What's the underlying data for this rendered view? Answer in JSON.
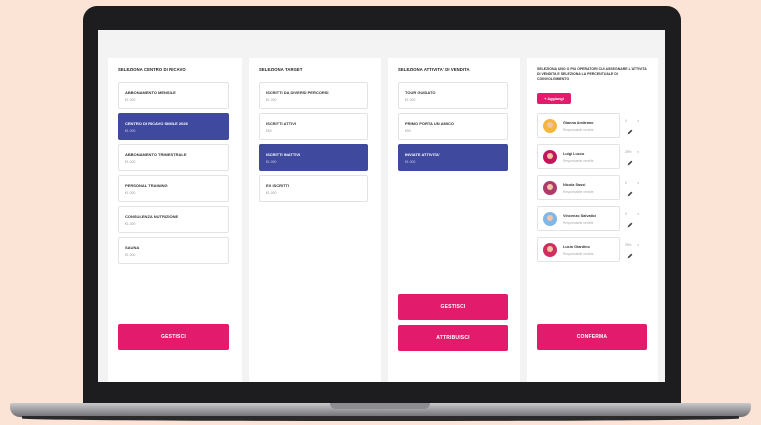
{
  "columns": {
    "centri": {
      "title": "SELEZIONA CENTRO DI RICAVO",
      "items": [
        {
          "title": "ABBONAMENTO MENSILE",
          "sub": "€1.000"
        },
        {
          "title": "CENTRO DI RICAVO SIMILE 2026",
          "sub": "€1.000"
        },
        {
          "title": "ABBONAMENTO TRIMESTRALE",
          "sub": "€1.000"
        },
        {
          "title": "PERSONAL TRAINING",
          "sub": "€1.000"
        },
        {
          "title": "CONSULENZA NUTRIZIONE",
          "sub": "€1.000"
        },
        {
          "title": "SAUNA",
          "sub": "€1.000"
        }
      ],
      "button": "GESTISCI"
    },
    "target": {
      "title": "SELEZIONA TARGET",
      "items": [
        {
          "title": "ISCRITTI DA DIVERSI PERCORSI",
          "sub": "€1.000"
        },
        {
          "title": "ISCRITTI ATTIVI",
          "sub": "€50"
        },
        {
          "title": "ISCRITTI INATTIVI",
          "sub": "€1.000"
        },
        {
          "title": "EX ISCRITTI",
          "sub": "€1.000"
        }
      ]
    },
    "attivita": {
      "title": "SELEZIONA ATTIVITA' DI VENDITA",
      "items": [
        {
          "title": "TOUR GUIDATO",
          "sub": "€1.000"
        },
        {
          "title": "PRIMO PORTA UN AMICO",
          "sub": "€50"
        },
        {
          "title": "INVIATE ATTIVITA'",
          "sub": "€1.000"
        }
      ],
      "button_primary": "GESTISCI",
      "button_secondary": "ATTRIBUISCI"
    },
    "operatori": {
      "info": "SELEZIONA UNO O PIU OPERATORI CUI ASSEGNARE L'ATTIVITA DI VENDITA E SELEZIONA LA PERCENTUALE DI COINVOLGIMENTO",
      "add_label": "+ Aggiungi",
      "operators": [
        {
          "name": "Gianna Amitrano",
          "role": "Responsabile vendite",
          "pct": "0",
          "color": "#f4b63b"
        },
        {
          "name": "Luigi Lucco",
          "role": "Responsabile vendite",
          "pct": "25%",
          "color": "#c2185b"
        },
        {
          "name": "Nicola Sassi",
          "role": "Responsabile vendite",
          "pct": "0",
          "color": "#ad3a6b"
        },
        {
          "name": "Vincenzo Salvatici",
          "role": "Responsabile vendite",
          "pct": "0",
          "color": "#7fb7e8"
        },
        {
          "name": "Lucio Giardino",
          "role": "Responsabile vendite",
          "pct": "25%",
          "color": "#d22d5e"
        }
      ],
      "button": "CONFERMA"
    }
  },
  "colors": {
    "accent": "#e31b6d",
    "selected": "#3f4a9f"
  }
}
